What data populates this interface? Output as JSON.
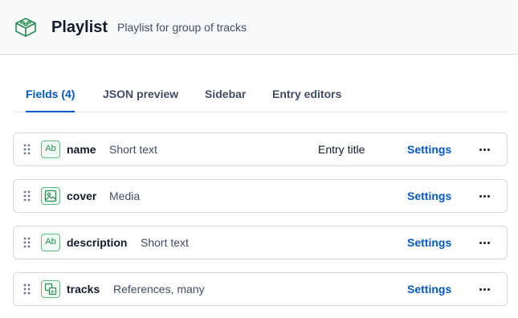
{
  "header": {
    "icon": "content-type-icon",
    "title": "Playlist",
    "description": "Playlist for group of tracks"
  },
  "tabs": [
    {
      "label": "Fields (4)",
      "active": true
    },
    {
      "label": "JSON preview",
      "active": false
    },
    {
      "label": "Sidebar",
      "active": false
    },
    {
      "label": "Entry editors",
      "active": false
    }
  ],
  "fields": [
    {
      "name": "name",
      "type": "Short text",
      "type_icon": "text-icon",
      "type_icon_text": "Ab",
      "badge": "Entry title",
      "settings_label": "Settings"
    },
    {
      "name": "cover",
      "type": "Media",
      "type_icon": "media-icon",
      "type_icon_text": "",
      "badge": "",
      "settings_label": "Settings"
    },
    {
      "name": "description",
      "type": "Short text",
      "type_icon": "text-icon",
      "type_icon_text": "Ab",
      "badge": "",
      "settings_label": "Settings"
    },
    {
      "name": "tracks",
      "type": "References, many",
      "type_icon": "references-icon",
      "type_icon_text": "",
      "badge": "",
      "settings_label": "Settings"
    }
  ],
  "colors": {
    "accent": "#0059c8",
    "field_icon_border": "#5dbd83",
    "header_bg": "#f7f9fa"
  }
}
